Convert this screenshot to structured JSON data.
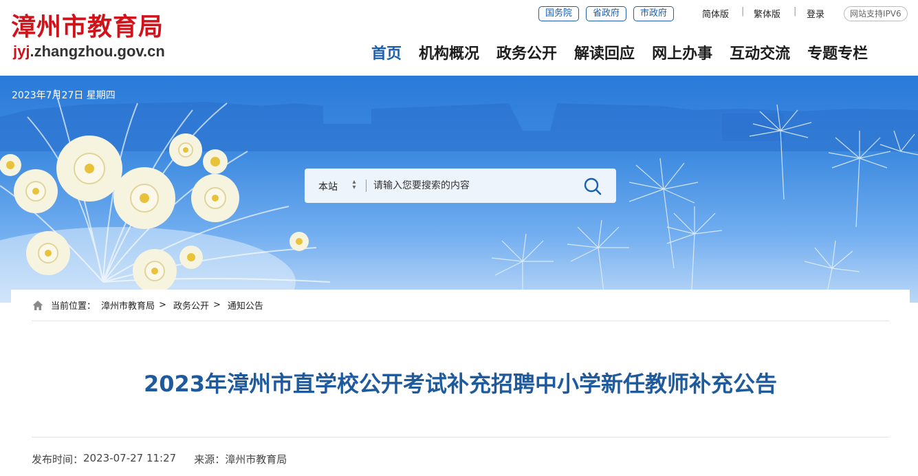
{
  "header": {
    "site_name": "漳州市教育局",
    "domain_prefix": "jyj",
    "domain_rest": ".zhangzhou.gov.cn",
    "top_links": [
      "国务院",
      "省政府",
      "市政府"
    ],
    "simplified": "简体版",
    "traditional": "繁体版",
    "login": "登录",
    "ipv6": "网站支持IPV6",
    "nav": [
      "首页",
      "机构概况",
      "政务公开",
      "解读回应",
      "网上办事",
      "互动交流",
      "专题专栏"
    ],
    "accent_color": "#1b5fae",
    "brand_red": "#d0121b"
  },
  "banner": {
    "date": "2023年7月27日 星期四",
    "search": {
      "scope": "本站",
      "placeholder": "请输入您要搜索的内容"
    }
  },
  "breadcrumb": {
    "label": "当前位置：",
    "items": [
      "漳州市教育局",
      "政务公开",
      "通知公告"
    ],
    "separator": ">"
  },
  "article": {
    "title": "2023年漳州市直学校公开考试补充招聘中小学新任教师补充公告",
    "publish_label": "发布时间：",
    "publish_time": "2023-07-27 11:27",
    "source_label": "来源：",
    "source": "漳州市教育局"
  }
}
